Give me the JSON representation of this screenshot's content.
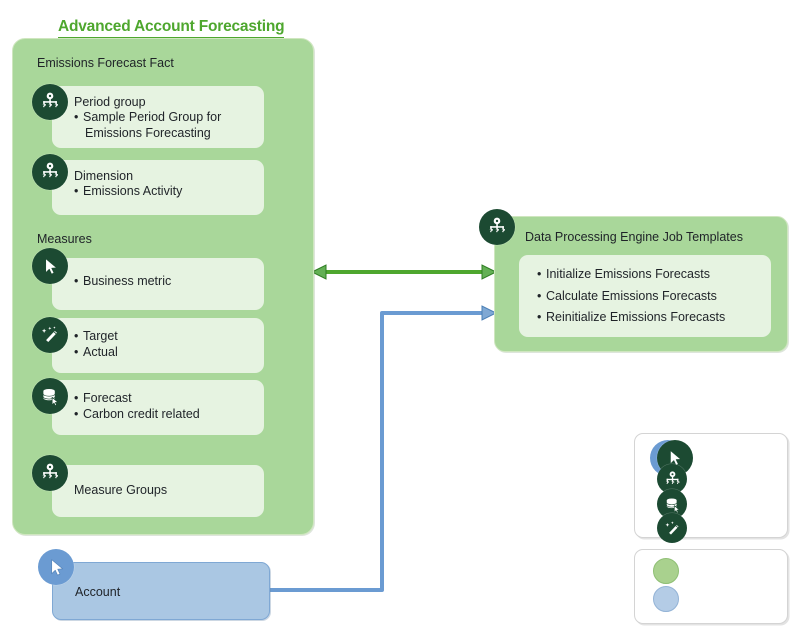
{
  "title": "Advanced Account Forecasting",
  "colors": {
    "title_green": "#4ea72e",
    "container_green": "#a9d79a",
    "card_green": "#e6f3e1",
    "badge_dark_green": "#1c4a32",
    "account_blue": "#aac7e3",
    "arrow_green": "#4ea72e",
    "arrow_blue": "#6b9bd2",
    "legend_swatch_green": "#a9d18e",
    "legend_swatch_blue": "#b4cce6"
  },
  "fact_container": {
    "heading": "Emissions Forecast Fact",
    "measures_heading": "Measures",
    "cards": [
      {
        "icon": "hierarchy-icon",
        "title": "Period group",
        "bullets": [
          "Sample Period Group for",
          "Emissions Forecasting"
        ]
      },
      {
        "icon": "hierarchy-icon",
        "title": "Dimension",
        "bullets": [
          "Emissions Activity"
        ]
      },
      {
        "icon": "cursor-icon",
        "title": "",
        "bullets": [
          "Business metric"
        ]
      },
      {
        "icon": "magic-wand-icon",
        "title": "",
        "bullets": [
          "Target",
          "Actual"
        ]
      },
      {
        "icon": "database-cursor-icon",
        "title": "",
        "bullets": [
          "Forecast",
          "Carbon credit related"
        ]
      },
      {
        "icon": "hierarchy-icon",
        "title": "Measure Groups",
        "bullets": []
      }
    ]
  },
  "dpe_box": {
    "icon": "hierarchy-icon",
    "heading": "Data Processing Engine Job Templates",
    "bullets": [
      "Initialize Emissions Forecasts",
      "Calculate Emissions Forecasts",
      "Reinitialize Emissions Forecasts"
    ]
  },
  "account_box": {
    "icon": "cursor-icon",
    "label": "Account"
  },
  "legend": {
    "icons_panel": [
      {
        "icon": "cursor-icon"
      },
      {
        "icon": "hierarchy-icon"
      },
      {
        "icon": "database-cursor-icon"
      },
      {
        "icon": "magic-wand-icon"
      }
    ],
    "colors_panel": [
      {
        "swatch": "green-circle"
      },
      {
        "swatch": "blue-circle"
      }
    ]
  },
  "connectors": [
    {
      "name": "fact-to-dpe",
      "style": "double-arrow",
      "color": "#4ea72e"
    },
    {
      "name": "account-to-dpe",
      "style": "single-arrow",
      "color": "#6b9bd2"
    }
  ]
}
